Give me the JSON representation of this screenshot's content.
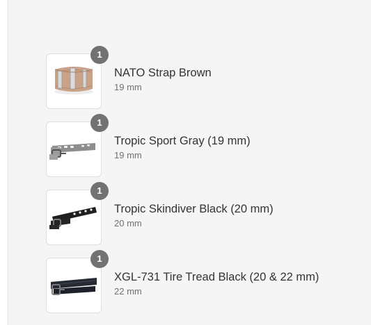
{
  "cart": {
    "items": [
      {
        "quantity": "1",
        "name": "NATO Strap Brown",
        "variant": "19 mm",
        "thumbnail_icon": "nato-strap-brown-image"
      },
      {
        "quantity": "1",
        "name": "Tropic Sport Gray (19 mm)",
        "variant": "19 mm",
        "thumbnail_icon": "tropic-strap-gray-image"
      },
      {
        "quantity": "1",
        "name": "Tropic Skindiver Black (20 mm)",
        "variant": "20 mm",
        "thumbnail_icon": "tropic-strap-black-image"
      },
      {
        "quantity": "1",
        "name": "XGL-731 Tire Tread Black (20 & 22 mm)",
        "variant": "22 mm",
        "thumbnail_icon": "tire-tread-strap-black-image"
      }
    ]
  }
}
